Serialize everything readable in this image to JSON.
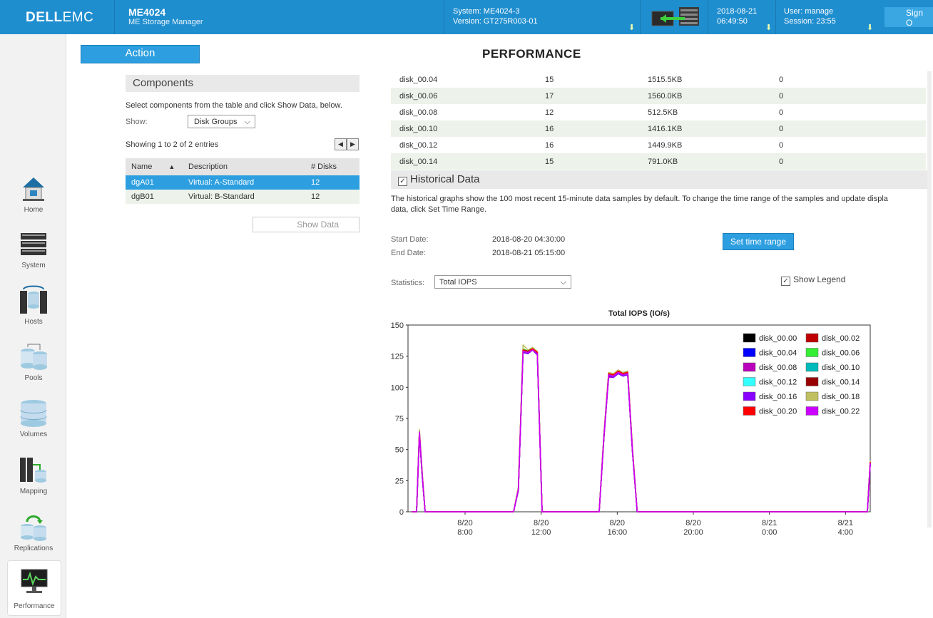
{
  "header": {
    "logo_bold": "DELL",
    "logo_rest": "EMC",
    "product": "ME4024",
    "product_sub": "ME Storage Manager",
    "system": "System: ME4024-3",
    "version": "Version: GT275R003-01",
    "date": "2018-08-21",
    "time": "06:49:50",
    "user": "User: manage",
    "session": "Session: 23:55",
    "signout": "Sign O",
    "arrow": "⬇"
  },
  "sidebar": [
    {
      "label": "Home",
      "icon": "home-icon"
    },
    {
      "label": "System",
      "icon": "system-icon"
    },
    {
      "label": "Hosts",
      "icon": "hosts-icon"
    },
    {
      "label": "Pools",
      "icon": "pools-icon"
    },
    {
      "label": "Volumes",
      "icon": "volumes-icon"
    },
    {
      "label": "Mapping",
      "icon": "mapping-icon"
    },
    {
      "label": "Replications",
      "icon": "replications-icon"
    },
    {
      "label": "Performance",
      "icon": "performance-icon"
    }
  ],
  "action_label": "Action",
  "page_title": "PERFORMANCE",
  "components": {
    "heading": "Components",
    "instructions": "Select components from the table and click Show Data, below.",
    "show_label": "Show:",
    "show_value": "Disk Groups",
    "entries": "Showing 1 to 2 of 2 entries",
    "columns": [
      "Name",
      "Description",
      "# Disks"
    ],
    "rows": [
      [
        "dgA01",
        "Virtual: A-Standard",
        "12"
      ],
      [
        "dgB01",
        "Virtual: B-Standard",
        "12"
      ]
    ],
    "show_data": "Show Data"
  },
  "disks": [
    [
      "disk_00.04",
      "15",
      "1515.5KB",
      "0"
    ],
    [
      "disk_00.06",
      "17",
      "1560.0KB",
      "0"
    ],
    [
      "disk_00.08",
      "12",
      "512.5KB",
      "0"
    ],
    [
      "disk_00.10",
      "16",
      "1416.1KB",
      "0"
    ],
    [
      "disk_00.12",
      "16",
      "1449.9KB",
      "0"
    ],
    [
      "disk_00.14",
      "15",
      "791.0KB",
      "0"
    ]
  ],
  "historical": {
    "heading": "Historical Data",
    "description": "The historical graphs show the 100 most recent 15-minute data samples by default. To change the time range of the samples and update displa data, click Set Time Range.",
    "start_label": "Start Date:",
    "start_value": "2018-08-20 04:30:00",
    "end_label": "End Date:",
    "end_value": "2018-08-21 05:15:00",
    "set_time_range": "Set time range",
    "statistics_label": "Statistics:",
    "statistics_value": "Total IOPS",
    "show_legend": "Show Legend"
  },
  "chart_data": {
    "type": "line",
    "title": "Total IOPS (IO/s)",
    "ylim": [
      0,
      150
    ],
    "yticks": [
      0,
      25,
      50,
      75,
      100,
      125,
      150
    ],
    "xlim": [
      5.0,
      29.3
    ],
    "xticks": [
      {
        "x": 8,
        "l1": "8/20",
        "l2": "8:00"
      },
      {
        "x": 12,
        "l1": "8/20",
        "l2": "12:00"
      },
      {
        "x": 16,
        "l1": "8/20",
        "l2": "16:00"
      },
      {
        "x": 20,
        "l1": "8/20",
        "l2": "20:00"
      },
      {
        "x": 24,
        "l1": "8/21",
        "l2": "0:00"
      },
      {
        "x": 28,
        "l1": "8/21",
        "l2": "4:00"
      }
    ],
    "x": [
      5.2,
      5.45,
      5.6,
      5.75,
      5.9,
      10.3,
      10.55,
      10.8,
      11.05,
      11.3,
      11.55,
      11.8,
      12.05,
      12.3,
      12.55,
      12.8,
      14.8,
      15.05,
      15.3,
      15.55,
      15.8,
      16.05,
      16.3,
      16.55,
      16.8,
      17.05,
      17.3,
      28.9,
      29.15,
      29.3
    ],
    "series": [
      {
        "name": "disk_00.00",
        "color": "#000000",
        "values": [
          0,
          0,
          62,
          28,
          0,
          0,
          0,
          18,
          128,
          127,
          130,
          126,
          0,
          0,
          0,
          0,
          0,
          0,
          60,
          110,
          109,
          112,
          110,
          111,
          48,
          0,
          0,
          0,
          0,
          38
        ]
      },
      {
        "name": "disk_00.02",
        "color": "#c00000",
        "values": [
          0,
          0,
          64,
          30,
          0,
          0,
          0,
          18,
          130,
          129,
          131,
          128,
          0,
          0,
          0,
          0,
          0,
          0,
          62,
          111,
          110,
          113,
          111,
          113,
          50,
          0,
          0,
          0,
          0,
          40
        ]
      },
      {
        "name": "disk_00.04",
        "color": "#0000ff",
        "values": [
          0,
          0,
          63,
          28,
          0,
          0,
          0,
          17,
          129,
          128,
          131,
          126,
          0,
          0,
          0,
          0,
          0,
          0,
          60,
          109,
          108,
          111,
          109,
          110,
          48,
          0,
          0,
          0,
          0,
          39
        ]
      },
      {
        "name": "disk_00.06",
        "color": "#33ee33",
        "values": [
          0,
          0,
          65,
          30,
          0,
          0,
          0,
          19,
          131,
          129,
          132,
          128,
          0,
          0,
          0,
          0,
          0,
          0,
          61,
          111,
          111,
          113,
          111,
          112,
          49,
          0,
          0,
          0,
          0,
          40
        ]
      },
      {
        "name": "disk_00.08",
        "color": "#bb00bb",
        "values": [
          0,
          0,
          64,
          29,
          0,
          0,
          0,
          18,
          128,
          127,
          130,
          127,
          0,
          0,
          0,
          0,
          0,
          0,
          60,
          108,
          108,
          111,
          109,
          110,
          48,
          0,
          0,
          0,
          0,
          39
        ]
      },
      {
        "name": "disk_00.10",
        "color": "#00bbbb",
        "values": [
          0,
          0,
          63,
          29,
          0,
          0,
          0,
          18,
          129,
          128,
          130,
          127,
          0,
          0,
          0,
          0,
          0,
          0,
          61,
          110,
          109,
          112,
          110,
          111,
          49,
          0,
          0,
          0,
          0,
          39
        ]
      },
      {
        "name": "disk_00.12",
        "color": "#33ffff",
        "values": [
          0,
          0,
          64,
          29,
          0,
          0,
          0,
          18,
          129,
          128,
          131,
          127,
          0,
          0,
          0,
          0,
          0,
          0,
          61,
          110,
          109,
          112,
          110,
          111,
          49,
          0,
          0,
          0,
          0,
          40
        ]
      },
      {
        "name": "disk_00.14",
        "color": "#990000",
        "values": [
          0,
          0,
          65,
          30,
          0,
          0,
          0,
          19,
          130,
          129,
          131,
          128,
          0,
          0,
          0,
          0,
          0,
          0,
          62,
          111,
          110,
          113,
          111,
          112,
          50,
          0,
          0,
          0,
          0,
          40
        ]
      },
      {
        "name": "disk_00.16",
        "color": "#8800ff",
        "values": [
          0,
          0,
          63,
          28,
          0,
          0,
          0,
          17,
          128,
          127,
          130,
          126,
          0,
          0,
          0,
          0,
          0,
          0,
          60,
          109,
          108,
          111,
          109,
          110,
          48,
          0,
          0,
          0,
          0,
          38
        ]
      },
      {
        "name": "disk_00.18",
        "color": "#c0c060",
        "values": [
          0,
          0,
          66,
          31,
          0,
          0,
          0,
          20,
          134,
          130,
          132,
          129,
          0,
          0,
          0,
          0,
          0,
          0,
          63,
          112,
          111,
          114,
          112,
          113,
          51,
          0,
          0,
          0,
          0,
          41
        ]
      },
      {
        "name": "disk_00.20",
        "color": "#ff0000",
        "values": [
          0,
          0,
          64,
          29,
          0,
          0,
          0,
          18,
          130,
          128,
          131,
          128,
          0,
          0,
          0,
          0,
          0,
          0,
          61,
          111,
          110,
          113,
          111,
          112,
          49,
          0,
          0,
          0,
          0,
          40
        ]
      },
      {
        "name": "disk_00.22",
        "color": "#cc00ff",
        "values": [
          0,
          0,
          64,
          29,
          0,
          0,
          0,
          18,
          129,
          128,
          130,
          127,
          0,
          0,
          0,
          0,
          0,
          0,
          61,
          110,
          109,
          112,
          110,
          111,
          49,
          0,
          0,
          0,
          0,
          39
        ]
      }
    ]
  }
}
